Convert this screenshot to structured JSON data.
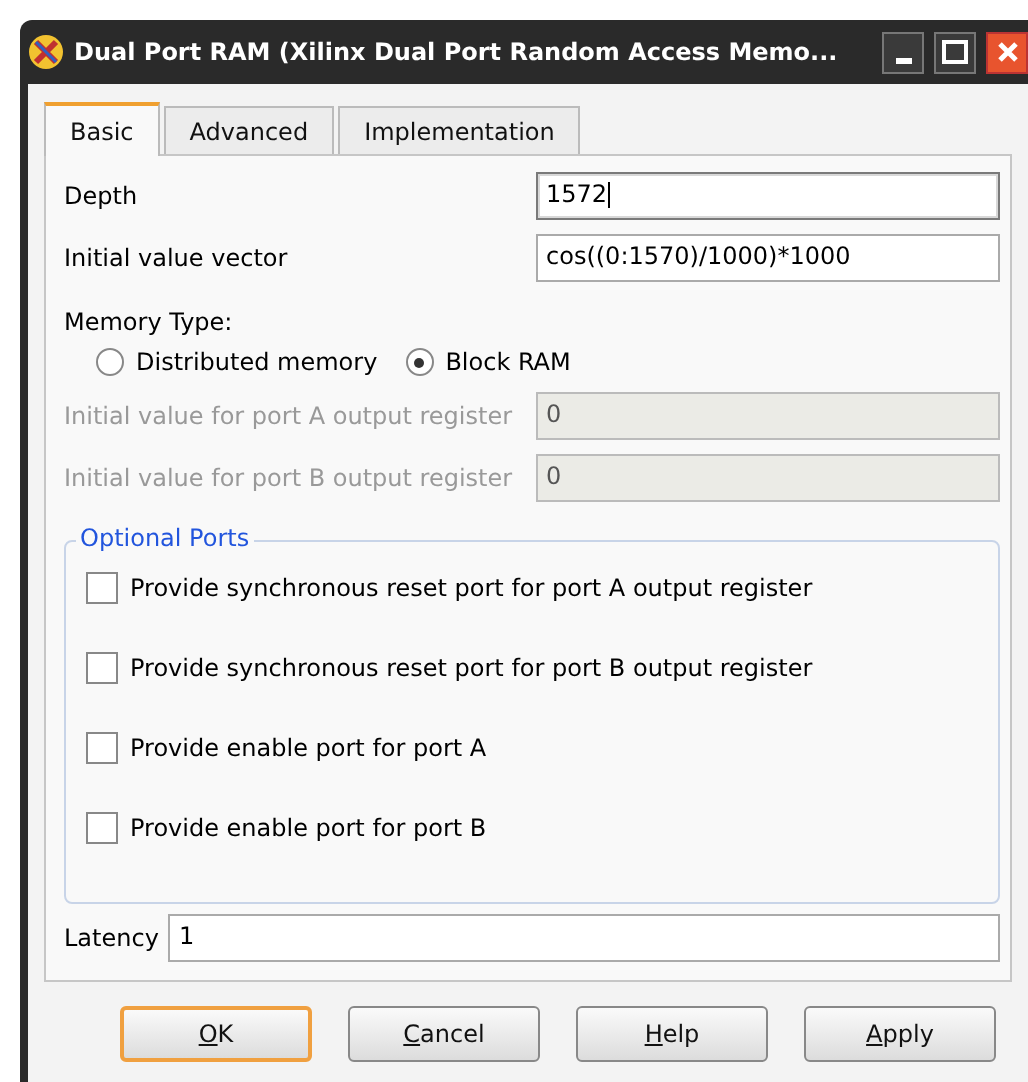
{
  "window": {
    "title": "Dual Port RAM (Xilinx Dual Port Random Access Memo..."
  },
  "tabs": [
    {
      "label": "Basic",
      "selected": true
    },
    {
      "label": "Advanced",
      "selected": false
    },
    {
      "label": "Implementation",
      "selected": false
    }
  ],
  "fields": [
    {
      "label": "Depth",
      "value": "1572",
      "disabled": false,
      "focused": true
    },
    {
      "label": "Initial value vector",
      "value": "cos((0:1570)/1000)*1000",
      "disabled": false,
      "focused": false
    }
  ],
  "memory_type": {
    "label": "Memory Type:",
    "options": [
      {
        "label": "Distributed memory",
        "selected": false
      },
      {
        "label": "Block RAM",
        "selected": true
      }
    ]
  },
  "register_fields": [
    {
      "label": "Initial value for port A output register",
      "value": "0",
      "disabled": true
    },
    {
      "label": "Initial value for port B output register",
      "value": "0",
      "disabled": true
    }
  ],
  "optional_ports": {
    "title": "Optional Ports",
    "options": [
      {
        "label": "Provide synchronous reset port for port A output register",
        "checked": false
      },
      {
        "label": "Provide synchronous reset port for port B output register",
        "checked": false
      },
      {
        "label": "Provide enable port for port A",
        "checked": false
      },
      {
        "label": "Provide enable port for port B",
        "checked": false
      }
    ]
  },
  "latency": {
    "label": "Latency",
    "value": "1"
  },
  "buttons": [
    {
      "label": "OK",
      "default": true
    },
    {
      "label": "Cancel",
      "default": false
    },
    {
      "label": "Help",
      "default": false
    },
    {
      "label": "Apply",
      "default": false
    }
  ]
}
